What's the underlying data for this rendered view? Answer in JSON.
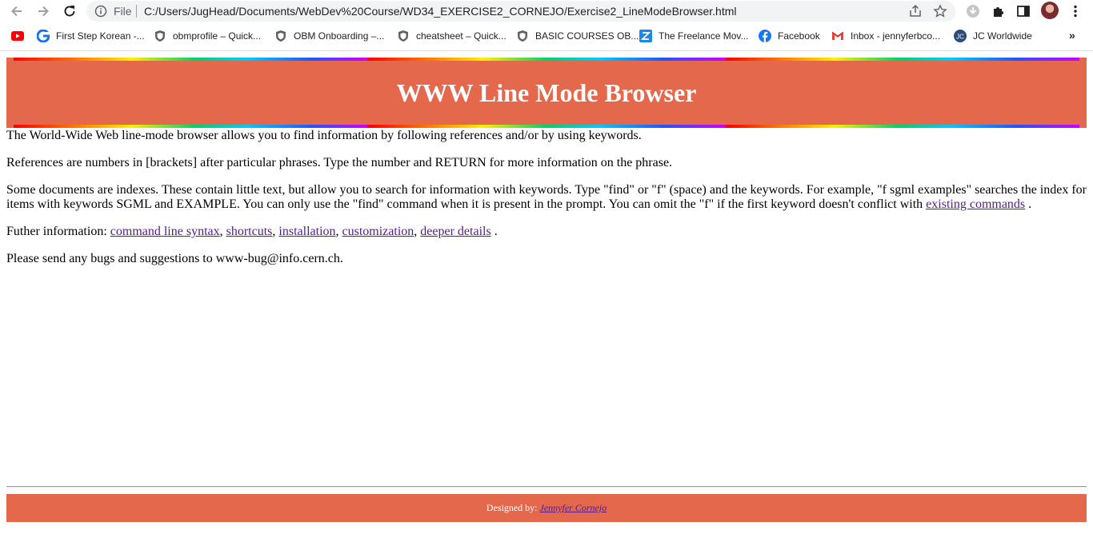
{
  "browser": {
    "omnibox": {
      "scheme_label": "File",
      "url": "C:/Users/JugHead/Documents/WebDev%20Course/WD34_EXERCISE2_CORNEJO/Exercise2_LineModeBrowser.html"
    },
    "bookmarks": [
      {
        "icon": "youtube-icon",
        "label": ""
      },
      {
        "icon": "google-icon",
        "label": "First Step Korean -..."
      },
      {
        "icon": "shield-icon",
        "label": "obmprofile – Quick..."
      },
      {
        "icon": "shield-icon",
        "label": "OBM Onboarding –..."
      },
      {
        "icon": "shield-icon",
        "label": "cheatsheet – Quick..."
      },
      {
        "icon": "shield-icon",
        "label": "BASIC COURSES OB..."
      },
      {
        "icon": "freelance-icon",
        "label": "The Freelance Mov..."
      },
      {
        "icon": "facebook-icon",
        "label": "Facebook"
      },
      {
        "icon": "gmail-icon",
        "label": "Inbox - jennyferbco..."
      },
      {
        "icon": "jc-icon",
        "label": "JC Worldwide"
      }
    ],
    "more_label": "»"
  },
  "page": {
    "title": "WWW Line Mode Browser",
    "p1": "The World-Wide Web line-mode browser allows you to find information by following references and/or by using keywords.",
    "p2": "References are numbers in [brackets] after particular phrases. Type the number and RETURN for more information on the phrase.",
    "p3_text": "Some documents are indexes. These contain little text, but allow you to search for information with keywords. Type \"find\" or \"f\" (space) and the keywords. For example, \"f sgml examples\" searches the index for items with keywords SGML and EXAMPLE. You can only use the \"find\" command when it is present in the prompt. You can omit the \"f\" if the first keyword doesn't conflict with",
    "p3_link": "existing commands",
    "p3_end": " .",
    "p4_prefix": "Futher information: ",
    "p4_links": [
      "command line syntax",
      "shortcuts",
      "installation",
      "customization",
      "deeper details"
    ],
    "p4_end": " .",
    "p5": "Please send any bugs and suggestions to www-bug@info.cern.ch.",
    "footer_prefix": "Designed by:",
    "footer_link": "Jennyfer Cornejo"
  },
  "colors": {
    "header_bg": "#e4694c",
    "link": "#551a8b"
  }
}
